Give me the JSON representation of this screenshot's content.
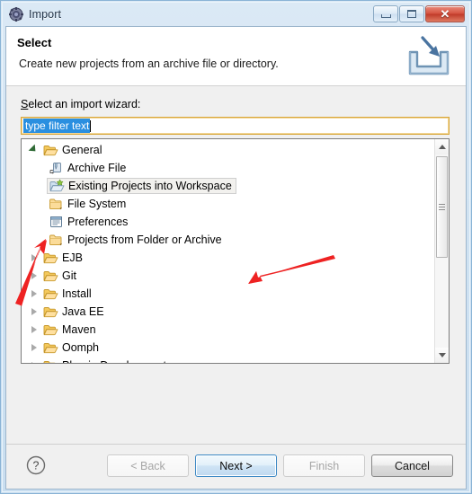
{
  "window": {
    "title": "Import",
    "title_icon": "eclipse-gear-icon",
    "controls": {
      "minimize": "minimize-icon",
      "maximize": "maximize-icon",
      "close": "✕"
    }
  },
  "header": {
    "title": "Select",
    "description": "Create new projects from an archive file or directory.",
    "icon": "import-arrow-into-tray-icon"
  },
  "body": {
    "wizard_label_prefix": "S",
    "wizard_label_rest": "elect an import wizard:",
    "filter": {
      "value": "type filter text",
      "placeholder": "type filter text",
      "selected": true
    },
    "tree": [
      {
        "label": "General",
        "level": 1,
        "state": "expanded",
        "icon": "folder-open-icon",
        "selected": false
      },
      {
        "label": "Archive File",
        "level": 2,
        "state": "leaf",
        "icon": "archive-file-icon",
        "selected": false
      },
      {
        "label": "Existing Projects into Workspace",
        "level": 2,
        "state": "leaf",
        "icon": "projects-import-icon",
        "selected": true
      },
      {
        "label": "File System",
        "level": 2,
        "state": "leaf",
        "icon": "folder-closed-icon",
        "selected": false
      },
      {
        "label": "Preferences",
        "level": 2,
        "state": "leaf",
        "icon": "preferences-icon",
        "selected": false
      },
      {
        "label": "Projects from Folder or Archive",
        "level": 2,
        "state": "leaf",
        "icon": "folder-closed-icon",
        "selected": false
      },
      {
        "label": "EJB",
        "level": 1,
        "state": "collapsed",
        "icon": "folder-open-icon",
        "selected": false
      },
      {
        "label": "Git",
        "level": 1,
        "state": "collapsed",
        "icon": "folder-open-icon",
        "selected": false
      },
      {
        "label": "Install",
        "level": 1,
        "state": "collapsed",
        "icon": "folder-open-icon",
        "selected": false
      },
      {
        "label": "Java EE",
        "level": 1,
        "state": "collapsed",
        "icon": "folder-open-icon",
        "selected": false
      },
      {
        "label": "Maven",
        "level": 1,
        "state": "collapsed",
        "icon": "folder-open-icon",
        "selected": false
      },
      {
        "label": "Oomph",
        "level": 1,
        "state": "collapsed",
        "icon": "folder-open-icon",
        "selected": false
      },
      {
        "label": "Plug-in Development",
        "level": 1,
        "state": "collapsed",
        "icon": "folder-open-icon",
        "selected": false
      }
    ]
  },
  "buttons": {
    "help": "?",
    "back": "< Back",
    "back_accel": "B",
    "next": "Next >",
    "next_accel": "N",
    "finish": "Finish",
    "finish_accel": "F",
    "cancel": "Cancel"
  },
  "annotations": [
    {
      "name": "arrow-to-general-expander",
      "color": "#ee2222"
    },
    {
      "name": "arrow-to-selected-wizard",
      "color": "#ee2222"
    }
  ],
  "colors": {
    "accent": "#2a8fe0",
    "focus_border": "#d8a73a",
    "annotation_red": "#ee2222",
    "close_button": "#d5523f"
  }
}
